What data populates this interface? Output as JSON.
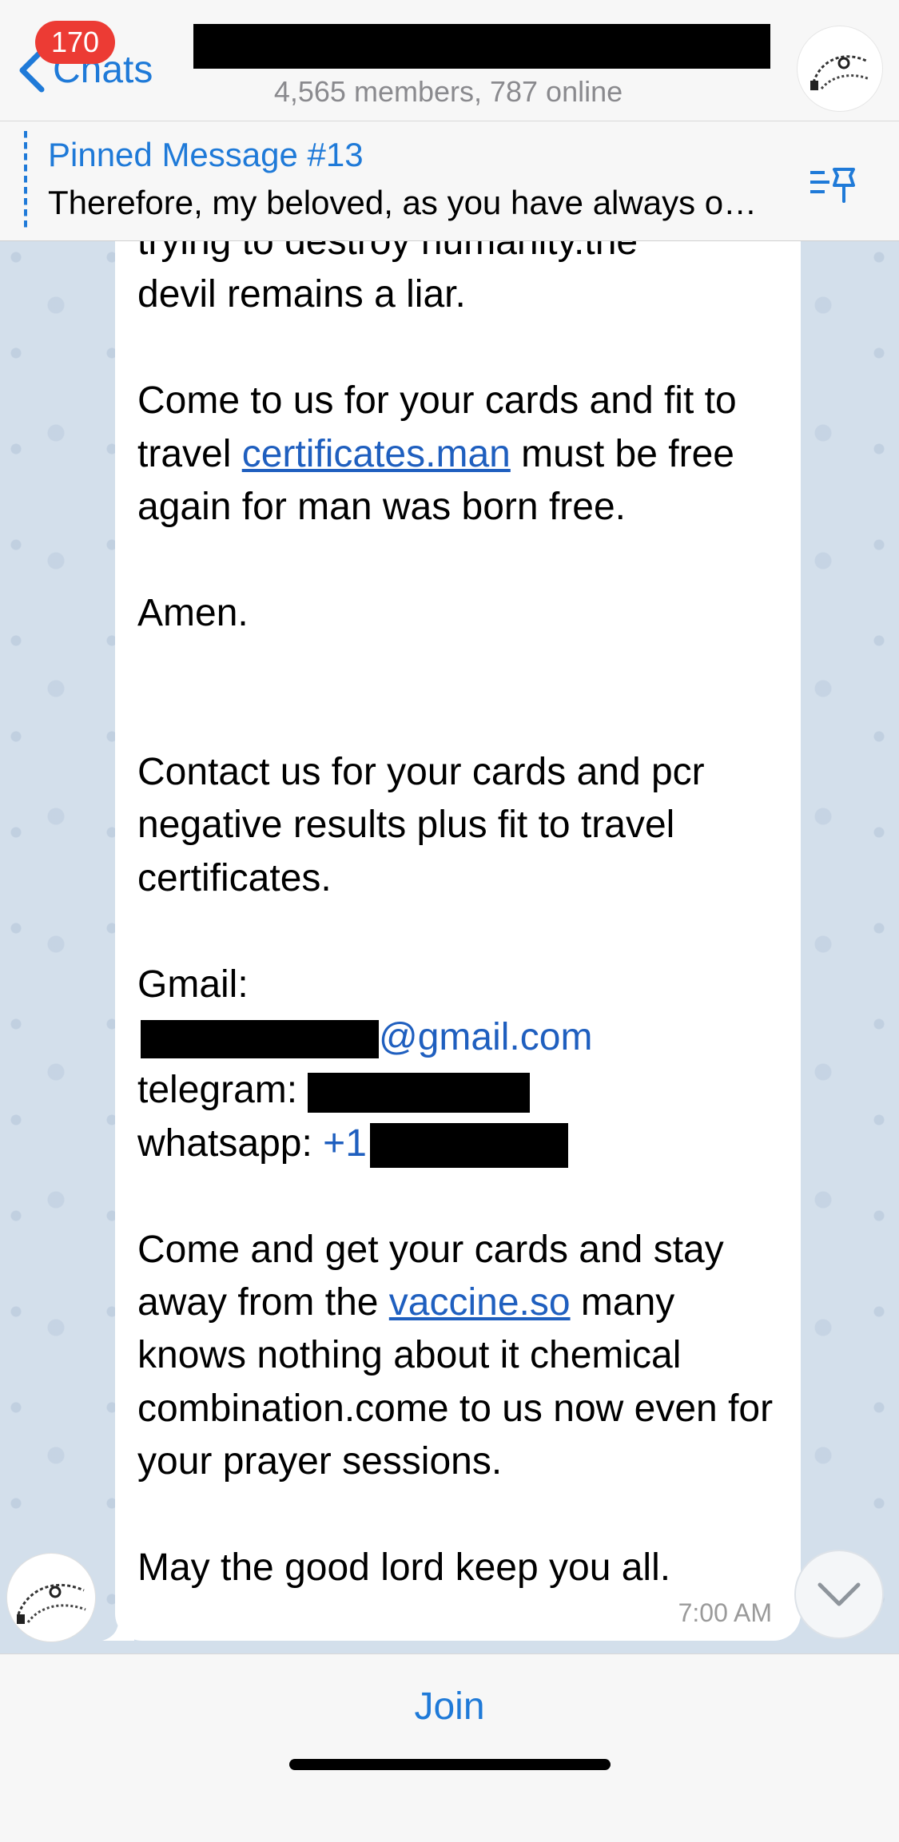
{
  "header": {
    "back_label": "Chats",
    "unread_count": "170",
    "subtitle": "4,565 members, 787 online",
    "avatar_icon": "bracelet-avatar-icon"
  },
  "pinned": {
    "title": "Pinned Message #13",
    "text": "Therefore, my beloved, as you have always o…"
  },
  "message": {
    "line1": "trying to destroy humanity.the",
    "line2": "devil remains a liar.",
    "p2_before": "Come to us for your cards and fit to travel ",
    "p2_link": "certificates.man",
    "p2_after": " must be free again for man was born free.",
    "p3": "Amen.",
    "p4": "Contact us for your cards and pcr negative results plus fit to travel certificates.",
    "gmail_label": "Gmail:",
    "gmail_domain": "@gmail.com",
    "telegram_label": "telegram: ",
    "whatsapp_label": "whatsapp: ",
    "whatsapp_prefix": "+1",
    "p6_before": "Come and get your cards and stay away from the ",
    "p6_link": "vaccine.so",
    "p6_after": " many knows nothing about it chemical combination.come to us now even for your prayer sessions.",
    "p7": "May the good lord keep you all.",
    "time": "7:00 AM"
  },
  "bottom": {
    "join_label": "Join"
  },
  "colors": {
    "accent": "#1f7ad8",
    "link": "#1f5fbf",
    "badge": "#ec3b34",
    "chat_bg": "#d3dfeb"
  }
}
